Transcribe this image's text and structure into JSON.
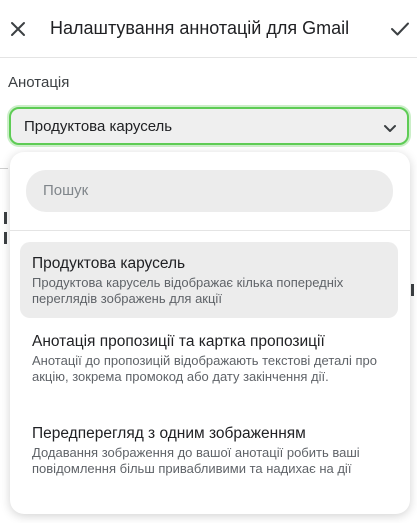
{
  "header": {
    "title": "Налаштування аннотацій для Gmail",
    "close_icon": "close-icon",
    "confirm_icon": "check-icon"
  },
  "annotation": {
    "label": "Анотація",
    "selected_value": "Продуктова карусель",
    "accent_color": "#5ecc55"
  },
  "dropdown": {
    "search_placeholder": "Пошук",
    "options": [
      {
        "title": "Продуктова карусель",
        "description": "Продуктова карусель відображає кілька попередніх переглядів зображень для акції",
        "selected": true
      },
      {
        "title": "Анотація пропозиції та картка пропозиції",
        "description": "Анотації до пропозицій відображають текстові деталі про акцію, зокрема промокод або дату закінчення дії.",
        "selected": false
      },
      {
        "title": "Передперегляд з одним зображенням",
        "description": "Додавання зображення до вашої анотації робить ваші повідомлення більш привабливими та надихає на дії",
        "selected": false
      }
    ]
  }
}
